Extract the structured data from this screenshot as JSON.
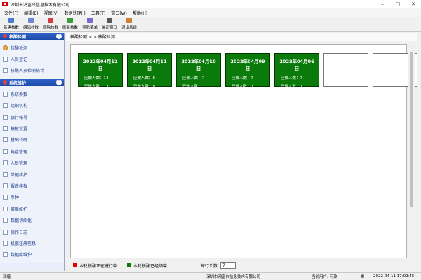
{
  "window": {
    "title": "深圳市鸿富兴信息技术有限公司"
  },
  "menu": [
    "文件(F)",
    "编辑(E)",
    "视图(V)",
    "数据处理(I)",
    "工具(T)",
    "窗口(W)",
    "帮助(H)"
  ],
  "toolbar": [
    {
      "label": "新建核数",
      "icon": "new-doc-icon",
      "color": "#4a7fd0"
    },
    {
      "label": "编辑核数",
      "icon": "edit-icon",
      "color": "#6a8ad0"
    },
    {
      "label": "删除核数",
      "icon": "delete-icon",
      "color": "#d04040"
    },
    {
      "label": "刷新核数",
      "icon": "refresh-icon",
      "color": "#3a9a3a"
    },
    {
      "label": "导航菜单",
      "icon": "navigation-icon",
      "color": "#7a6ad0"
    },
    {
      "label": "关闭窗口",
      "icon": "close-window-icon",
      "color": "#555555"
    },
    {
      "label": "退出系统",
      "icon": "exit-icon",
      "color": "#d08030"
    }
  ],
  "sidebar": {
    "panel1": {
      "title": "核酸检测",
      "items": [
        "核酸检测",
        "人员登记",
        "核酸人员检测统计"
      ]
    },
    "panel2": {
      "title": "系统维护",
      "items": [
        "系统参数",
        "组织机构",
        "银行帐号",
        "模板设置",
        "基础代码",
        "角色管理",
        "人员管理",
        "单据维护",
        "报表模板",
        "币种",
        "菜单维护",
        "数据初始化",
        "操作日志",
        "机器注册信息",
        "数据库维护"
      ]
    }
  },
  "main": {
    "breadcrumb": "核酸检测 > > 核酸检测",
    "count_labels": {
      "expected": "应做人数：",
      "done": "已做人数："
    },
    "cards": [
      {
        "date": "2022年04月12日",
        "expected": "14",
        "done": "13"
      },
      {
        "date": "2022年04月11日",
        "expected": "8",
        "done": "8"
      },
      {
        "date": "2022年04月10日",
        "expected": "7",
        "done": "7"
      },
      {
        "date": "2022年04月09日",
        "expected": "7",
        "done": "7"
      },
      {
        "date": "2022年04月06日",
        "expected": "7",
        "done": "7"
      }
    ],
    "legend": {
      "in_progress": "本轮核酸正在进行中",
      "finished": "本轮核酸已经结束",
      "per_row_label": "每行个数",
      "per_row_value": "7"
    }
  },
  "colors": {
    "in_progress": "#e00000",
    "finished": "#0a7a0a",
    "header": "#1d4aa8"
  },
  "status": {
    "ready": "就绪",
    "company": "深圳市鸿富兴信息技术有限公司",
    "user": "当前用户: 何玲",
    "datetime": "2022-04-11 17:02:45"
  }
}
